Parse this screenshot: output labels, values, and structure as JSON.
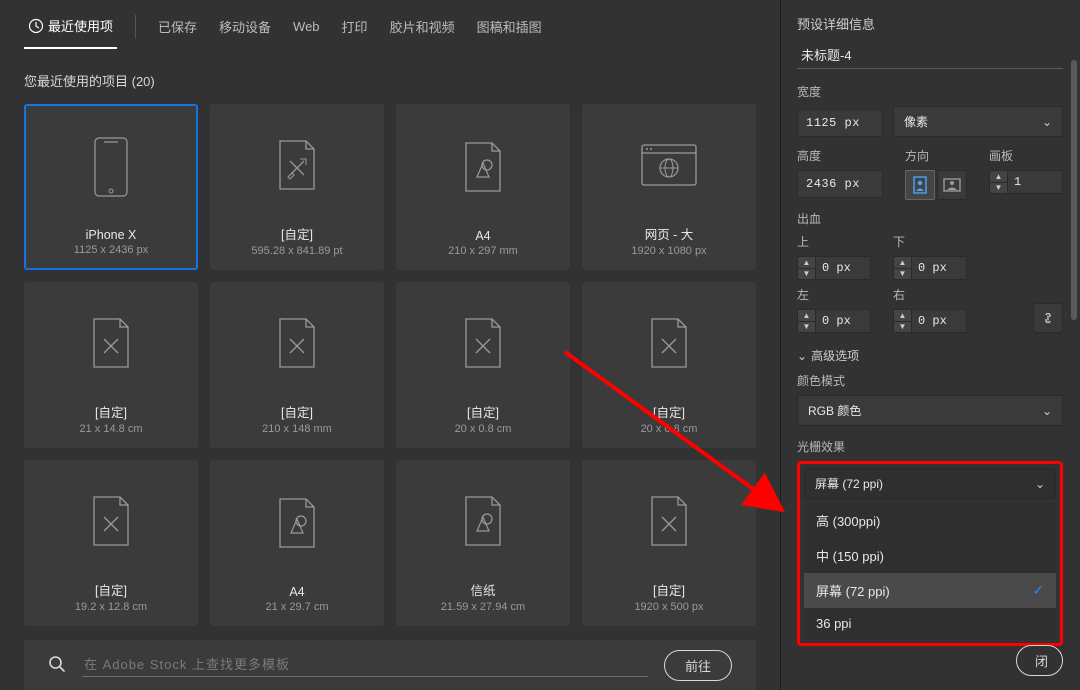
{
  "tabs": {
    "recent": "最近使用项",
    "saved": "已保存",
    "mobile": "移动设备",
    "web": "Web",
    "print": "打印",
    "film": "胶片和视频",
    "art": "图稿和插图"
  },
  "section_title": "您最近使用的项目 (20)",
  "presets": [
    {
      "name": "iPhone X",
      "dims": "1125 x 2436 px",
      "icon": "phone"
    },
    {
      "name": "[自定]",
      "dims": "595.28 x 841.89 pt",
      "icon": "custom"
    },
    {
      "name": "A4",
      "dims": "210 x 297 mm",
      "icon": "a4"
    },
    {
      "name": "网页 - 大",
      "dims": "1920 x 1080 px",
      "icon": "web"
    },
    {
      "name": "[自定]",
      "dims": "21 x 14.8 cm",
      "icon": "custom"
    },
    {
      "name": "[自定]",
      "dims": "210 x 148 mm",
      "icon": "custom"
    },
    {
      "name": "[自定]",
      "dims": "20 x 0.8 cm",
      "icon": "custom"
    },
    {
      "name": "[自定]",
      "dims": "20 x 0.8 cm",
      "icon": "custom"
    },
    {
      "name": "[自定]",
      "dims": "19.2 x 12.8 cm",
      "icon": "custom"
    },
    {
      "name": "A4",
      "dims": "21 x 29.7 cm",
      "icon": "a4"
    },
    {
      "name": "信纸",
      "dims": "21.59 x 27.94 cm",
      "icon": "a4"
    },
    {
      "name": "[自定]",
      "dims": "1920 x 500 px",
      "icon": "custom"
    }
  ],
  "search": {
    "placeholder": "在 Adobe Stock 上查找更多模板",
    "go": "前往"
  },
  "details": {
    "title": "预设详细信息",
    "doc_name": "未标题-4",
    "width_label": "宽度",
    "width_value": "1125 px",
    "unit_label": "像素",
    "height_label": "高度",
    "height_value": "2436 px",
    "orient_label": "方向",
    "artboard_label": "画板",
    "artboard_value": "1",
    "bleed_label": "出血",
    "top_label": "上",
    "bottom_label": "下",
    "left_label": "左",
    "right_label": "右",
    "bleed_value": "0 px",
    "advanced_label": "高级选项",
    "colormode_label": "颜色模式",
    "colormode_value": "RGB 颜色",
    "raster_label": "光栅效果",
    "raster_value": "屏幕 (72 ppi)",
    "raster_options": [
      "高 (300ppi)",
      "中 (150 ppi)",
      "屏幕 (72 ppi)",
      "36 ppi"
    ],
    "close_partial": "闭"
  }
}
